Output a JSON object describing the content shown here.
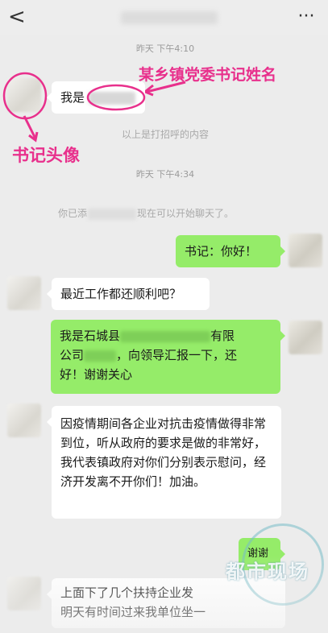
{
  "header": {
    "back_glyph": "<",
    "more_glyph": "···"
  },
  "timestamps": {
    "first": "昨天 下午4:10",
    "second": "昨天 下午4:34"
  },
  "system": {
    "greeting_note": "以上是打招呼的内容",
    "added_prefix": "你已添",
    "added_suffix": "现在可以开始聊天了。"
  },
  "annotations": {
    "secretary_name": "某乡镇党委书记姓名",
    "secretary_avatar": "书记头像",
    "color": "#e8308c"
  },
  "messages": [
    {
      "side": "left",
      "prefix": "我是"
    },
    {
      "side": "right",
      "text": "书记：你好！"
    },
    {
      "side": "left",
      "text": "最近工作都还顺利吧？"
    },
    {
      "side": "right",
      "line1_prefix": "我是石城县",
      "line1_suffix": "有限",
      "line2_prefix": "公司",
      "line2_suffix": "，向领导汇报一下，还",
      "line3": "好！谢谢关心"
    },
    {
      "side": "left",
      "text": "因疫情期间各企业对抗击疫情做得非常到位，听从政府的要求是做的非常好，我代表镇政府对你们分别表示慰问，经济开发离不开你们！加油。"
    },
    {
      "side": "right",
      "text": "谢谢"
    },
    {
      "side": "left",
      "line1": "上面下了几个扶持企业发",
      "line2": "明天有时间过来我单位坐一"
    }
  ],
  "watermark": {
    "text": "都市现场"
  },
  "colors": {
    "chat_bg": "#ececec",
    "bubble_left": "#ffffff",
    "bubble_right": "#95ec69"
  }
}
